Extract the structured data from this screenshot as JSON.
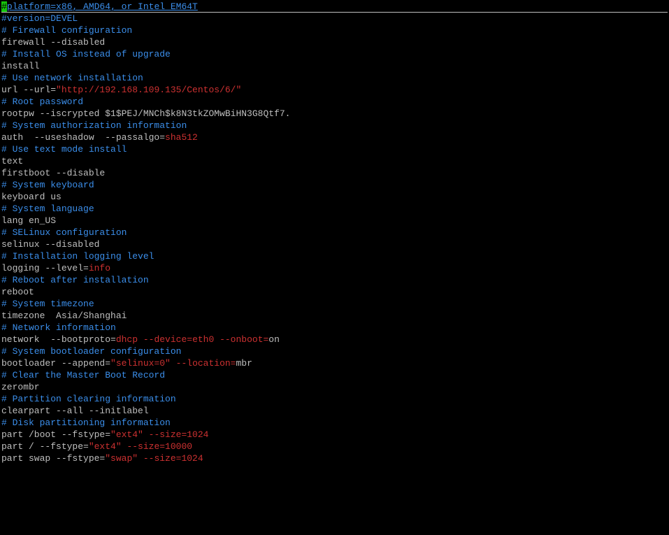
{
  "lines": [
    {
      "segments": [
        {
          "text": "#",
          "cls": "cursor"
        },
        {
          "text": "platform=x86, AMD64, or Intel EM64T",
          "cls": "blue underline"
        }
      ],
      "top": true
    },
    {
      "segments": [
        {
          "text": "#version=DEVEL",
          "cls": "blue"
        }
      ]
    },
    {
      "segments": [
        {
          "text": "# Firewall configuration",
          "cls": "blue"
        }
      ]
    },
    {
      "segments": [
        {
          "text": "firewall --disabled",
          "cls": "white"
        }
      ]
    },
    {
      "segments": [
        {
          "text": "# Install OS instead of upgrade",
          "cls": "blue"
        }
      ]
    },
    {
      "segments": [
        {
          "text": "install",
          "cls": "white"
        }
      ]
    },
    {
      "segments": [
        {
          "text": "# Use network installation",
          "cls": "blue"
        }
      ]
    },
    {
      "segments": [
        {
          "text": "url --url=",
          "cls": "white"
        },
        {
          "text": "\"http://192.168.109.135/Centos/6/\"",
          "cls": "red"
        }
      ]
    },
    {
      "segments": [
        {
          "text": "# Root password",
          "cls": "blue"
        }
      ]
    },
    {
      "segments": [
        {
          "text": "rootpw --iscrypted $1$PEJ/MNCh$k8N3tkZOMwBiHN3G8Qtf7.",
          "cls": "white"
        }
      ]
    },
    {
      "segments": [
        {
          "text": "# System authorization information",
          "cls": "blue"
        }
      ]
    },
    {
      "segments": [
        {
          "text": "auth  --useshadow  --passalgo=",
          "cls": "white"
        },
        {
          "text": "sha512",
          "cls": "red"
        }
      ]
    },
    {
      "segments": [
        {
          "text": "# Use text mode install",
          "cls": "blue"
        }
      ]
    },
    {
      "segments": [
        {
          "text": "text",
          "cls": "white"
        }
      ]
    },
    {
      "segments": [
        {
          "text": "firstboot --disable",
          "cls": "white"
        }
      ]
    },
    {
      "segments": [
        {
          "text": "# System keyboard",
          "cls": "blue"
        }
      ]
    },
    {
      "segments": [
        {
          "text": "keyboard us",
          "cls": "white"
        }
      ]
    },
    {
      "segments": [
        {
          "text": "# System language",
          "cls": "blue"
        }
      ]
    },
    {
      "segments": [
        {
          "text": "lang en_US",
          "cls": "white"
        }
      ]
    },
    {
      "segments": [
        {
          "text": "# SELinux configuration",
          "cls": "blue"
        }
      ]
    },
    {
      "segments": [
        {
          "text": "selinux --disabled",
          "cls": "white"
        }
      ]
    },
    {
      "segments": [
        {
          "text": "# Installation logging level",
          "cls": "blue"
        }
      ]
    },
    {
      "segments": [
        {
          "text": "logging --level=",
          "cls": "white"
        },
        {
          "text": "info",
          "cls": "red"
        }
      ]
    },
    {
      "segments": [
        {
          "text": "# Reboot after installation",
          "cls": "blue"
        }
      ]
    },
    {
      "segments": [
        {
          "text": "reboot",
          "cls": "white"
        }
      ]
    },
    {
      "segments": [
        {
          "text": "# System timezone",
          "cls": "blue"
        }
      ]
    },
    {
      "segments": [
        {
          "text": "timezone  Asia/Shanghai",
          "cls": "white"
        }
      ]
    },
    {
      "segments": [
        {
          "text": "# Network information",
          "cls": "blue"
        }
      ]
    },
    {
      "segments": [
        {
          "text": "network  --bootproto=",
          "cls": "white"
        },
        {
          "text": "dhcp",
          "cls": "red"
        },
        {
          "text": " --device=",
          "cls": "red"
        },
        {
          "text": "eth0",
          "cls": "red"
        },
        {
          "text": " --onboot=",
          "cls": "red"
        },
        {
          "text": "on",
          "cls": "white"
        }
      ]
    },
    {
      "segments": [
        {
          "text": "# System bootloader configuration",
          "cls": "blue"
        }
      ]
    },
    {
      "segments": [
        {
          "text": "bootloader --append=",
          "cls": "white"
        },
        {
          "text": "\"selinux=0\"",
          "cls": "red"
        },
        {
          "text": " --location=",
          "cls": "red"
        },
        {
          "text": "mbr",
          "cls": "white"
        }
      ]
    },
    {
      "segments": [
        {
          "text": "# Clear the Master Boot Record",
          "cls": "blue"
        }
      ]
    },
    {
      "segments": [
        {
          "text": "zerombr",
          "cls": "white"
        }
      ]
    },
    {
      "segments": [
        {
          "text": "# Partition clearing information",
          "cls": "blue"
        }
      ]
    },
    {
      "segments": [
        {
          "text": "clearpart --all --initlabel",
          "cls": "white"
        }
      ]
    },
    {
      "segments": [
        {
          "text": "# Disk partitioning information",
          "cls": "blue"
        }
      ]
    },
    {
      "segments": [
        {
          "text": "part /boot --fstype=",
          "cls": "white"
        },
        {
          "text": "\"ext4\"",
          "cls": "red"
        },
        {
          "text": " --size=1024",
          "cls": "red"
        }
      ]
    },
    {
      "segments": [
        {
          "text": "part / --fstype=",
          "cls": "white"
        },
        {
          "text": "\"ext4\"",
          "cls": "red"
        },
        {
          "text": " --size=10000",
          "cls": "red"
        }
      ]
    },
    {
      "segments": [
        {
          "text": "part swap --fstype=",
          "cls": "white"
        },
        {
          "text": "\"swap\"",
          "cls": "red"
        },
        {
          "text": " --size=1024",
          "cls": "red"
        }
      ]
    }
  ]
}
